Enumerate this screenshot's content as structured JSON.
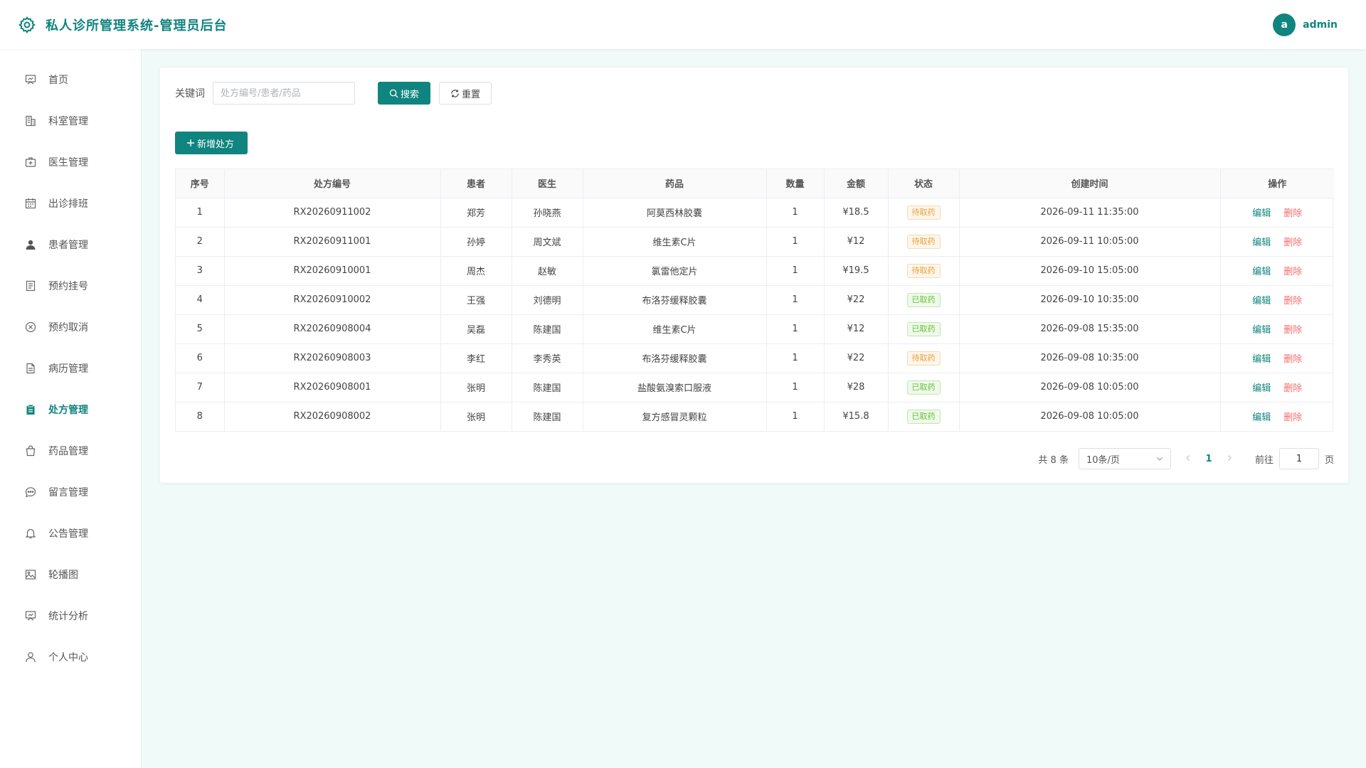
{
  "header": {
    "title": "私人诊所管理系统-管理员后台",
    "avatar_letter": "a",
    "username": "admin"
  },
  "sidebar": {
    "items": [
      {
        "label": "首页",
        "icon": "presentation-board-icon"
      },
      {
        "label": "科室管理",
        "icon": "building-icon"
      },
      {
        "label": "医生管理",
        "icon": "medical-kit-icon"
      },
      {
        "label": "出诊排班",
        "icon": "calendar-icon"
      },
      {
        "label": "患者管理",
        "icon": "user-filled-icon"
      },
      {
        "label": "预约挂号",
        "icon": "document-icon"
      },
      {
        "label": "预约取消",
        "icon": "circle-x-icon"
      },
      {
        "label": "病历管理",
        "icon": "file-text-icon"
      },
      {
        "label": "处方管理",
        "icon": "clipboard-icon",
        "active": true
      },
      {
        "label": "药品管理",
        "icon": "shopping-bag-icon"
      },
      {
        "label": "留言管理",
        "icon": "chat-bubble-icon"
      },
      {
        "label": "公告管理",
        "icon": "bell-icon"
      },
      {
        "label": "轮播图",
        "icon": "picture-icon"
      },
      {
        "label": "统计分析",
        "icon": "presentation-board-icon"
      },
      {
        "label": "个人中心",
        "icon": "user-outline-icon"
      }
    ]
  },
  "search": {
    "label": "关键词",
    "value": "",
    "placeholder": "处方编号/患者/药品",
    "search_label": "搜索",
    "reset_label": "重置"
  },
  "toolbar": {
    "add_label": "新增处方"
  },
  "table": {
    "columns": [
      "序号",
      "处方编号",
      "患者",
      "医生",
      "药品",
      "数量",
      "金额",
      "状态",
      "创建时间",
      "操作"
    ],
    "edit_label": "编辑",
    "delete_label": "删除",
    "rows": [
      {
        "index": "1",
        "code": "RX20260911002",
        "patient": "郑芳",
        "doctor": "孙晓燕",
        "drug": "阿莫西林胶囊",
        "qty": "1",
        "amount": "¥18.5",
        "status": "待取药",
        "status_type": "pending",
        "created": "2026-09-11 11:35:00"
      },
      {
        "index": "2",
        "code": "RX20260911001",
        "patient": "孙婷",
        "doctor": "周文斌",
        "drug": "维生素C片",
        "qty": "1",
        "amount": "¥12",
        "status": "待取药",
        "status_type": "pending",
        "created": "2026-09-11 10:05:00"
      },
      {
        "index": "3",
        "code": "RX20260910001",
        "patient": "周杰",
        "doctor": "赵敏",
        "drug": "氯雷他定片",
        "qty": "1",
        "amount": "¥19.5",
        "status": "待取药",
        "status_type": "pending",
        "created": "2026-09-10 15:05:00"
      },
      {
        "index": "4",
        "code": "RX20260910002",
        "patient": "王强",
        "doctor": "刘德明",
        "drug": "布洛芬缓释胶囊",
        "qty": "1",
        "amount": "¥22",
        "status": "已取药",
        "status_type": "done",
        "created": "2026-09-10 10:35:00"
      },
      {
        "index": "5",
        "code": "RX20260908004",
        "patient": "吴磊",
        "doctor": "陈建国",
        "drug": "维生素C片",
        "qty": "1",
        "amount": "¥12",
        "status": "已取药",
        "status_type": "done",
        "created": "2026-09-08 15:35:00"
      },
      {
        "index": "6",
        "code": "RX20260908003",
        "patient": "李红",
        "doctor": "李秀英",
        "drug": "布洛芬缓释胶囊",
        "qty": "1",
        "amount": "¥22",
        "status": "待取药",
        "status_type": "pending",
        "created": "2026-09-08 10:35:00"
      },
      {
        "index": "7",
        "code": "RX20260908001",
        "patient": "张明",
        "doctor": "陈建国",
        "drug": "盐酸氨溴索口服液",
        "qty": "1",
        "amount": "¥28",
        "status": "已取药",
        "status_type": "done",
        "created": "2026-09-08 10:05:00"
      },
      {
        "index": "8",
        "code": "RX20260908002",
        "patient": "张明",
        "doctor": "陈建国",
        "drug": "复方感冒灵颗粒",
        "qty": "1",
        "amount": "¥15.8",
        "status": "已取药",
        "status_type": "done",
        "created": "2026-09-08 10:05:00"
      }
    ]
  },
  "pagination": {
    "total_label": "共 8 条",
    "page_size": "10条/页",
    "current_page": "1",
    "goto_prefix": "前往",
    "goto_value": "1",
    "goto_suffix": "页"
  },
  "colors": {
    "primary": "#10847e",
    "danger": "#f56c6c",
    "warning": "#e6a23c",
    "success": "#67c23a"
  }
}
